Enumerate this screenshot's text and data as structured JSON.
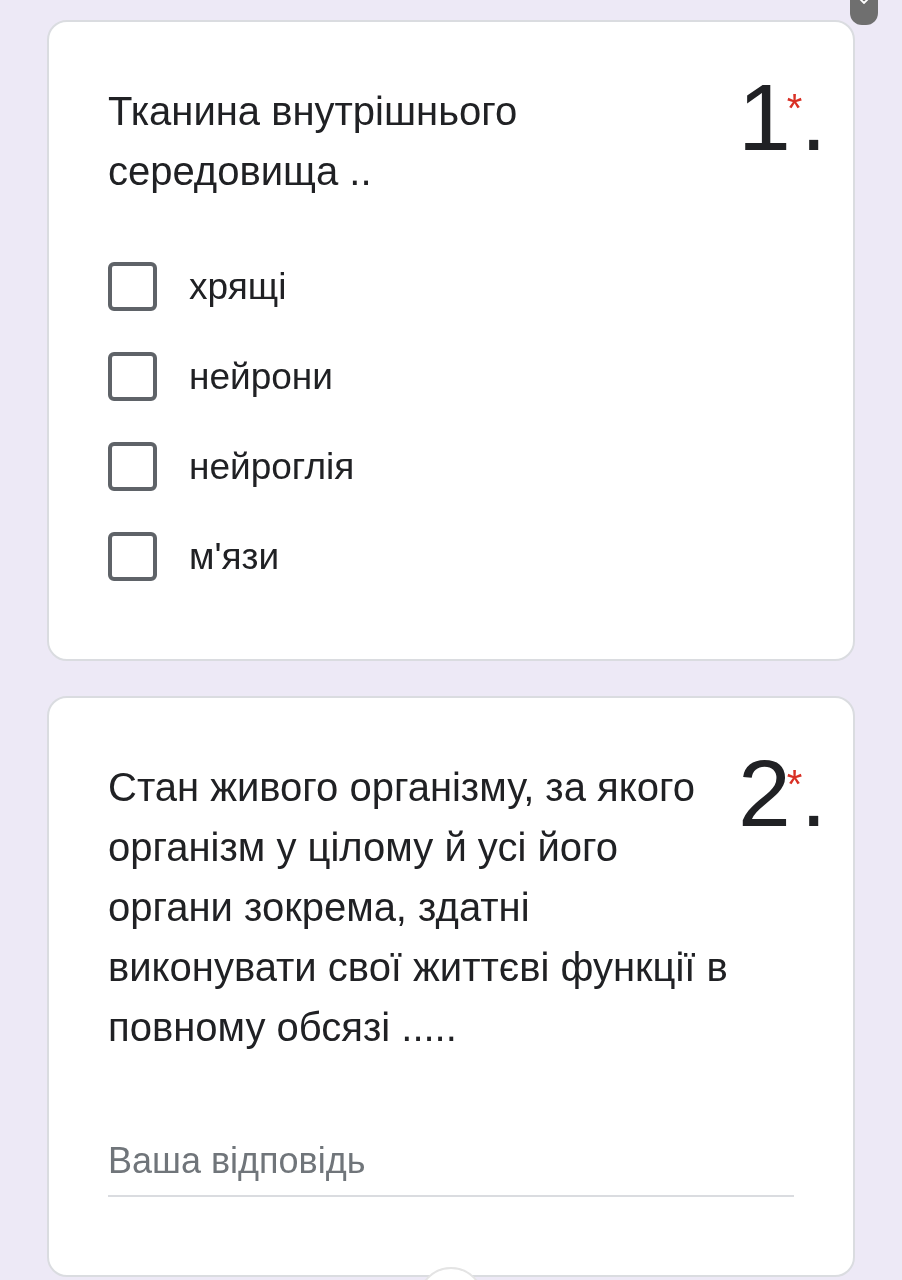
{
  "questions": [
    {
      "kind": "checkboxes",
      "number": "1$^{*}$.",
      "title": "Тканина внутрішнього середовища ..",
      "options": [
        {
          "label": "хрящі",
          "checked": false
        },
        {
          "label": "нейрони",
          "checked": false
        },
        {
          "label": "нейроглія",
          "checked": false
        },
        {
          "label": "м'язи",
          "checked": false
        }
      ]
    },
    {
      "kind": "short_answer",
      "number": "2$^{*}$.",
      "title": "Стан живого організму, за якого організм у цілому й усі його органи зокрема, здатні виконувати свої життєві функції в повному обсязі .....",
      "answer": {
        "placeholder": "Ваша відповідь"
      }
    }
  ]
}
